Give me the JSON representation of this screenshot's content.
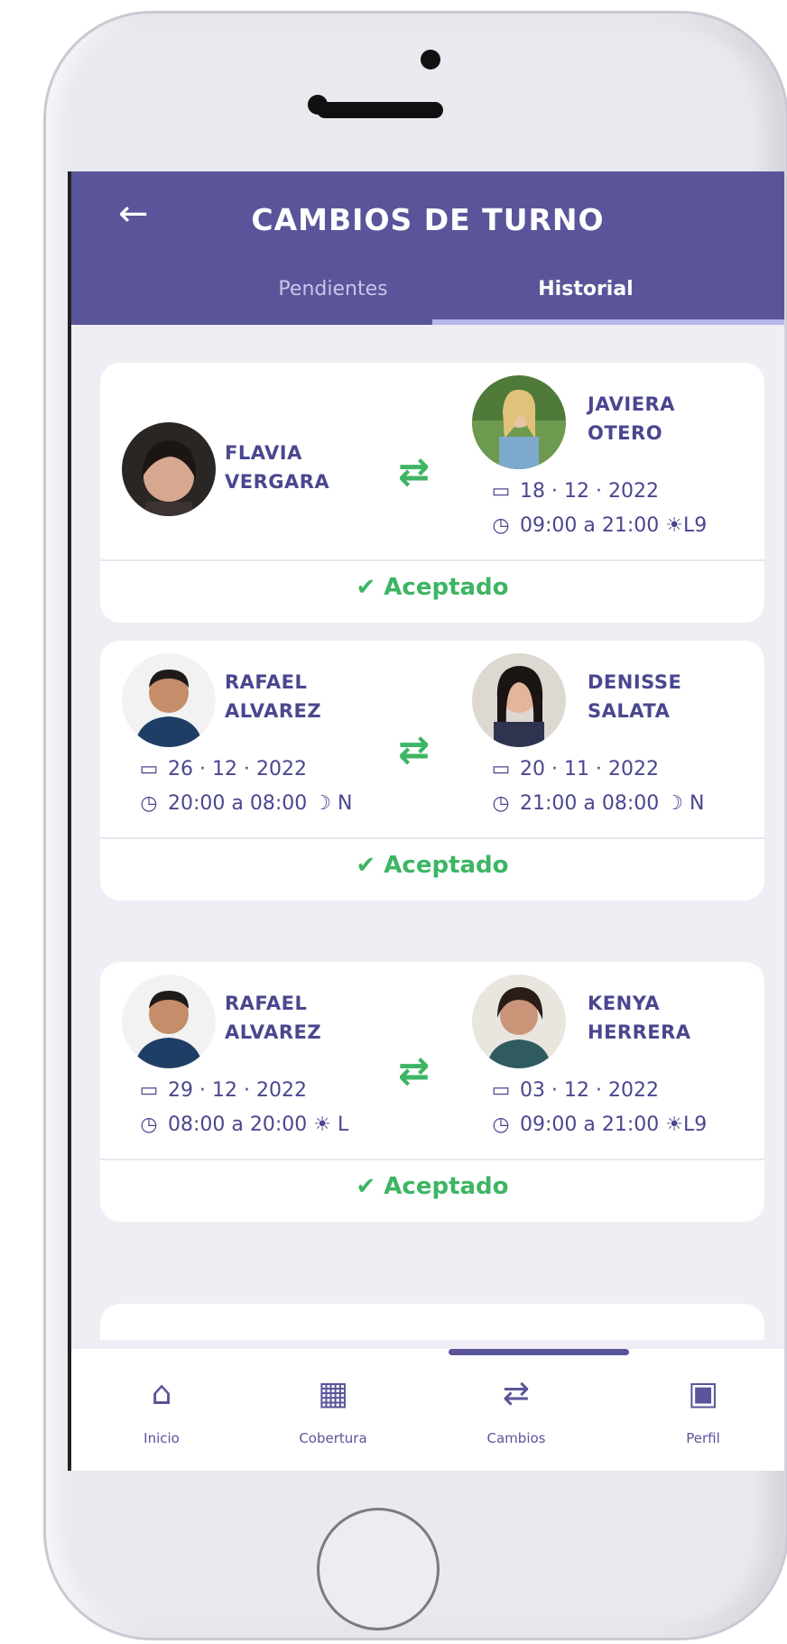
{
  "header": {
    "title": "CAMBIOS DE TURNO",
    "back_icon": "←"
  },
  "tabs": [
    {
      "label": "Pendientes"
    },
    {
      "label": "Historial"
    }
  ],
  "cards": [
    {
      "left": {
        "first": "FLAVIA",
        "last": "VERGARA"
      },
      "right": {
        "first": "JAVIERA",
        "last": "OTERO",
        "date": "18 · 12 · 2022",
        "time": "09:00 a 21:00",
        "shift_icon": "☀",
        "shift": "L9"
      },
      "swap_icon": "⇄",
      "status": "✔ Aceptado"
    },
    {
      "left": {
        "first": "RAFAEL",
        "last": "ALVAREZ",
        "date": "26 · 12 · 2022",
        "time": "20:00 a 08:00",
        "shift_icon": "☽",
        "shift": "N"
      },
      "right": {
        "first": "DENISSE",
        "last": "SALATA",
        "date": "20 · 11 · 2022",
        "time": "21:00 a 08:00",
        "shift_icon": "☽",
        "shift": "N"
      },
      "swap_icon": "⇄",
      "status": "✔ Aceptado"
    },
    {
      "left": {
        "first": "RAFAEL",
        "last": "ALVAREZ",
        "date": "29 · 12 · 2022",
        "time": "08:00 a 20:00",
        "shift_icon": "☀",
        "shift": "L"
      },
      "right": {
        "first": "KENYA",
        "last": "HERRERA",
        "date": "03 · 12 · 2022",
        "time": "09:00 a 21:00",
        "shift_icon": "☀",
        "shift": "L9"
      },
      "swap_icon": "⇄",
      "status": "✔ Aceptado"
    }
  ],
  "icons": {
    "calendar": "▭",
    "clock": "◷"
  },
  "nav": [
    {
      "label": "Inicio",
      "icon": "⌂"
    },
    {
      "label": "Cobertura",
      "icon": "▦"
    },
    {
      "label": "Cambios",
      "icon": "⇄"
    },
    {
      "label": "Perfil",
      "icon": "▣"
    }
  ],
  "colors": {
    "primary": "#5a559a",
    "accent": "#3db564",
    "text": "#4a478f"
  }
}
